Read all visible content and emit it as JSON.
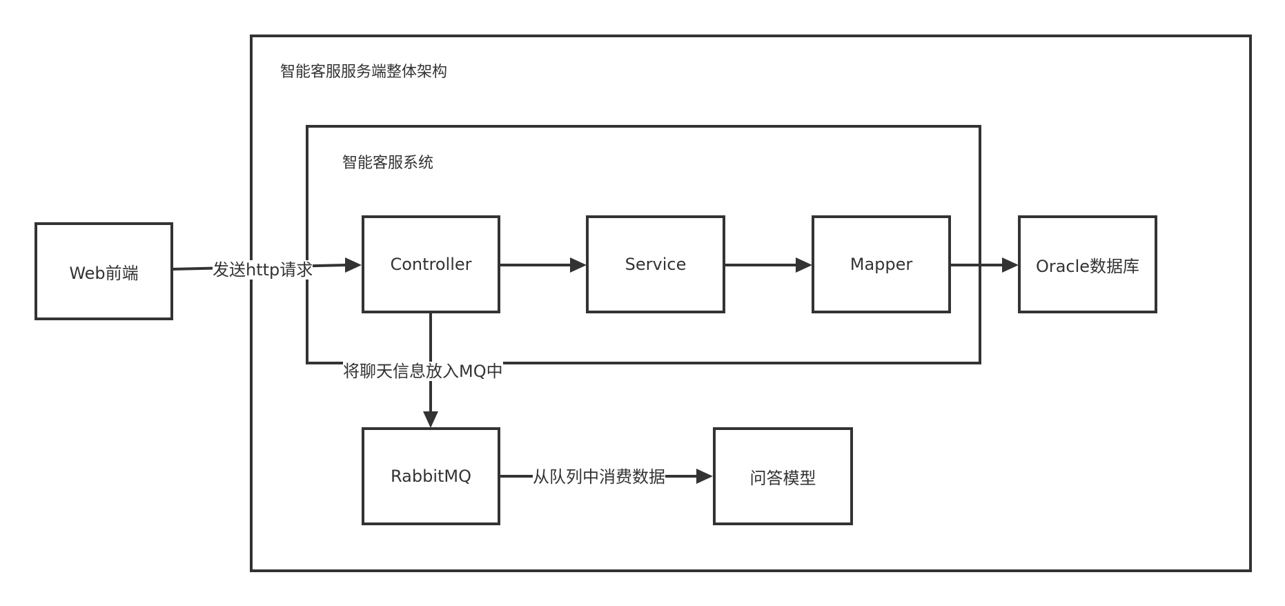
{
  "outer": {
    "title": "智能客服服务端整体架构"
  },
  "inner": {
    "title": "智能客服系统"
  },
  "nodes": {
    "web": "Web前端",
    "controller": "Controller",
    "service": "Service",
    "mapper": "Mapper",
    "oracle": "Oracle数据库",
    "rabbitmq": "RabbitMQ",
    "qa_model": "问答模型"
  },
  "edges": {
    "web_to_controller": "发送http请求",
    "controller_to_mq": "将聊天信息放入MQ中",
    "mq_to_model": "从队列中消费数据"
  }
}
